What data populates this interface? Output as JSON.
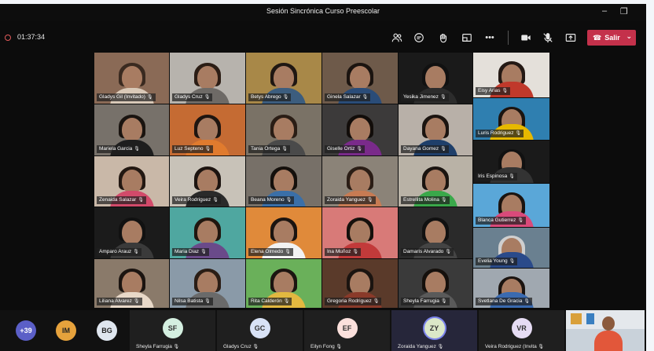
{
  "window": {
    "title": "Sesión Sincrónica Curso Preescolar"
  },
  "toolbar": {
    "timer": "01:37:34",
    "leave_label": "Salir"
  },
  "tiles": [
    {
      "name": "Gladys Gil (Invitado)",
      "bg": "#8a6a56",
      "shirt": "#d9c9b8",
      "hair": "#3a2a20"
    },
    {
      "name": "Gladys Cruz",
      "bg": "#b7b3ad",
      "shirt": "#6e6a66",
      "hair": "#2b1d15"
    },
    {
      "name": "Betys Abrego",
      "bg": "#a88848",
      "shirt": "#3c5d7e",
      "hair": "#1f1712"
    },
    {
      "name": "Ginela Salazar",
      "bg": "#6e5a4a",
      "shirt": "#2a4c78",
      "hair": "#1b1410"
    },
    {
      "name": "Yesika Jimenez",
      "bg": "#1a1a1a",
      "shirt": "#2c2c2c",
      "hair": "#111"
    },
    {
      "name": "Eisy Arias",
      "bg": "#e4e0da",
      "shirt": "#c0392b",
      "hair": "#241914"
    },
    {
      "name": "Mariela Garcia",
      "bg": "#77716a",
      "shirt": "#1e1e1e",
      "hair": "#1a1410"
    },
    {
      "name": "Luz Septeno",
      "bg": "#c56b33",
      "shirt": "#e07b2e",
      "hair": "#1e1510"
    },
    {
      "name": "Tania Ortega",
      "bg": "#7a7266",
      "shirt": "#4a4a4a",
      "hair": "#2a1d15"
    },
    {
      "name": "Giselle Ortiz",
      "bg": "#3c3a3a",
      "shirt": "#7a2a8a",
      "hair": "#120d0a"
    },
    {
      "name": "Dayana Gomez",
      "bg": "#b8b0a8",
      "shirt": "#1f3f6a",
      "hair": "#1b1410"
    },
    {
      "name": "Luris Rodriguez",
      "bg": "#2f7fb0",
      "shirt": "#e6b800",
      "hair": "#1b1410"
    },
    {
      "name": "Zenaida Salazar",
      "bg": "#c9b8a8",
      "shirt": "#d24a6a",
      "hair": "#231812"
    },
    {
      "name": "Veira Rodriguez",
      "bg": "#c8c2b8",
      "shirt": "#2a2a2a",
      "hair": "#1d1410"
    },
    {
      "name": "Beana Moreno",
      "bg": "#777068",
      "shirt": "#3a6fa8",
      "hair": "#15100c"
    },
    {
      "name": "Zoraida Yanguez",
      "bg": "#8b8378",
      "shirt": "#c77b53",
      "hair": "#2a1d15"
    },
    {
      "name": "Estrellita Molina",
      "bg": "#b9b2a6",
      "shirt": "#3aa84a",
      "hair": "#1a1410"
    },
    {
      "name": "Iris Espinosa",
      "bg": "#1a1a1a",
      "shirt": "#333",
      "hair": "#111"
    },
    {
      "name": "Blanca Gutierrez",
      "bg": "#5aa7d8",
      "shirt": "#d94a7a",
      "hair": "#1b1410"
    },
    {
      "name": "Amparo Arauz",
      "bg": "#1b1b1b",
      "shirt": "#3a3a3a",
      "hair": "#111"
    },
    {
      "name": "Maria Diaz",
      "bg": "#4fa7a0",
      "shirt": "#6a4a8a",
      "hair": "#20160f"
    },
    {
      "name": "Elena Olmedo",
      "bg": "#e08a3a",
      "shirt": "#f2f2f2",
      "hair": "#1b1410"
    },
    {
      "name": "Ina Muñoz",
      "bg": "#d87a78",
      "shirt": "#c23a3a",
      "hair": "#15100c"
    },
    {
      "name": "Damaris Alvarado",
      "bg": "#2a2a2a",
      "shirt": "#444",
      "hair": "#111"
    },
    {
      "name": "Evelia Young",
      "bg": "#6a8090",
      "shirt": "#2a4a8a",
      "hair": "#cfcfcf"
    },
    {
      "name": "Liliana Alvarez",
      "bg": "#8a7a6a",
      "shirt": "#e8d8c8",
      "hair": "#1b1410"
    },
    {
      "name": "Nilsa Batista",
      "bg": "#8a9aa8",
      "shirt": "#6a6a6a",
      "hair": "#2a1d15"
    },
    {
      "name": "Rita Calderón",
      "bg": "#6ab05a",
      "shirt": "#e2b840",
      "hair": "#1b1410"
    },
    {
      "name": "Gregoria Rodriguez",
      "bg": "#5a3a2a",
      "shirt": "#8a3a2a",
      "hair": "#1b1410"
    },
    {
      "name": "Sheyla Farrugia",
      "bg": "#3a3a3a",
      "shirt": "#5a5a5a",
      "hair": "#15100c"
    },
    {
      "name": "Svetlana De Gracia",
      "bg": "#a0a8b0",
      "shirt": "#3a6ab0",
      "hair": "#1b1410"
    }
  ],
  "bottom": {
    "overflow_count": "+39",
    "small_avatars": [
      {
        "initials": "IM",
        "color": "#e6a23c"
      },
      {
        "initials": "BG",
        "color": "#dfe6ef"
      }
    ],
    "participants": [
      {
        "initials": "SF",
        "name": "Sheyla Farrugia",
        "color": "#d4efe0"
      },
      {
        "initials": "GC",
        "name": "Gladys Cruz",
        "color": "#d8e2f6"
      },
      {
        "initials": "EF",
        "name": "Eilyn Fong",
        "color": "#fbe0dc"
      },
      {
        "initials": "ZY",
        "name": "Zoraida Yanguez",
        "color": "#dbe8c8"
      },
      {
        "initials": "VR",
        "name": "Veira Rodriguez (Invita",
        "color": "#e6dcf4"
      }
    ]
  }
}
